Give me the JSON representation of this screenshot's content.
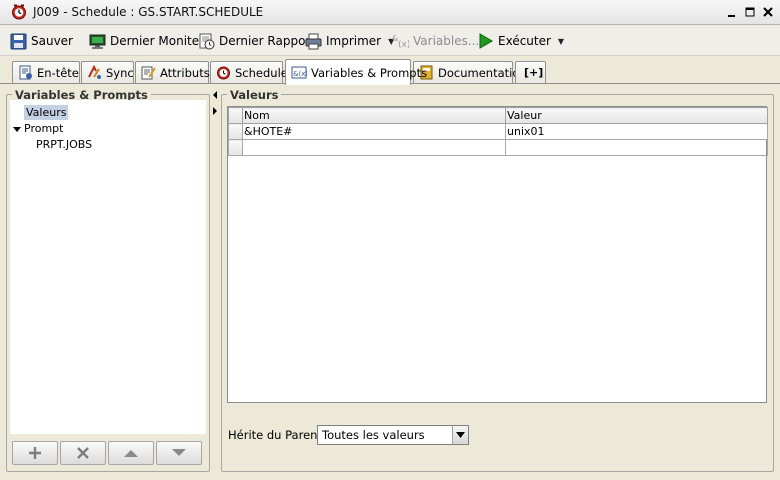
{
  "window": {
    "title": "J009 - Schedule : GS.START.SCHEDULE"
  },
  "toolbar": {
    "save": "Sauver",
    "last_monitor": "Dernier Moniteur",
    "last_report": "Dernier Rapport",
    "print": "Imprimer",
    "variables": "Variables...",
    "execute": "Exécuter"
  },
  "tabs": [
    {
      "label": "En-tête",
      "icon": "header-doc-icon"
    },
    {
      "label": "Sync",
      "icon": "sync-icon"
    },
    {
      "label": "Attributs",
      "icon": "attributes-icon"
    },
    {
      "label": "Schedule",
      "icon": "clock-icon"
    },
    {
      "label": "Variables & Prompts",
      "icon": "variables-icon",
      "active": true
    },
    {
      "label": "Documentation",
      "icon": "book-icon"
    },
    {
      "label": "[+]",
      "icon": "add-tab-icon"
    }
  ],
  "left": {
    "legend": "Variables & Prompts",
    "tree": {
      "valeurs": "Valeurs",
      "prompt": "Prompt",
      "prpt_jobs": "PRPT.JOBS"
    }
  },
  "right": {
    "legend": "Valeurs",
    "columns": [
      "Nom",
      "Valeur"
    ],
    "rows": [
      [
        "&HOTE#",
        "unix01"
      ],
      [
        "",
        ""
      ]
    ],
    "inherit_label": "Hérite du Parent:",
    "inherit_value": "Toutes les valeurs"
  },
  "colors": {
    "chrome": "#ece9d8",
    "selection": "#c4d0e4",
    "execute_green": "#1f9a1f"
  }
}
